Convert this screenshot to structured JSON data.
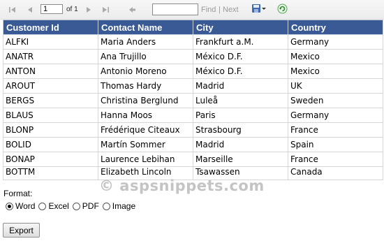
{
  "toolbar": {
    "page_value": "1",
    "of_label": "of 1",
    "find_value": "",
    "find_label": "Find",
    "separator": "|",
    "next_label": "Next",
    "icons": [
      "first-page-icon",
      "previous-page-icon",
      "next-page-icon",
      "last-page-icon",
      "back-icon",
      "export-save-icon",
      "refresh-icon"
    ]
  },
  "grid": {
    "columns": [
      "Customer Id",
      "Contact Name",
      "City",
      "Country"
    ],
    "rows": [
      [
        "ALFKI",
        "Maria Anders",
        "Frankfurt a.M.",
        "Germany"
      ],
      [
        "ANATR",
        "Ana Trujillo",
        "México D.F.",
        "Mexico"
      ],
      [
        "ANTON",
        "Antonio Moreno",
        "México D.F.",
        "Mexico"
      ],
      [
        "AROUT",
        "Thomas Hardy",
        "Madrid",
        "UK"
      ],
      [
        "BERGS",
        "Christina Berglund",
        "Luleå",
        "Sweden"
      ],
      [
        "BLAUS",
        "Hanna Moos",
        "Paris",
        "Germany"
      ],
      [
        "BLONP",
        "Frédérique Citeaux",
        "Strasbourg",
        "France"
      ],
      [
        "BOLID",
        "Martín Sommer",
        "Madrid",
        "Spain"
      ],
      [
        "BONAP",
        "Laurence Lebihan",
        "Marseille",
        "France"
      ],
      [
        "BOTTM",
        "Elizabeth Lincoln",
        "Tsawassen",
        "Canada"
      ]
    ]
  },
  "watermark": "© aspsnippets.com",
  "format": {
    "label": "Format:",
    "options": [
      "Word",
      "Excel",
      "PDF",
      "Image"
    ],
    "selected": "Word"
  },
  "export_label": "Export",
  "colors": {
    "header_bg": "#3a5a96",
    "header_text": "#ffffff"
  }
}
